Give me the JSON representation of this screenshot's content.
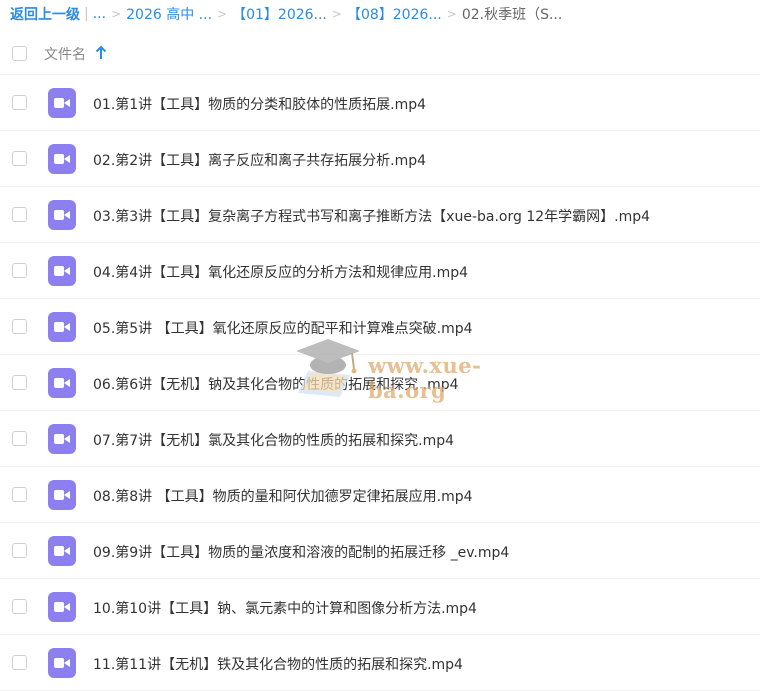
{
  "breadcrumb": {
    "back": "返回上一级",
    "bar": "|",
    "ellipsis": "...",
    "sep": ">",
    "items": [
      "2026 高中 ...",
      "【01】2026...",
      "【08】2026..."
    ],
    "current": "02.秋季班（S..."
  },
  "header": {
    "name_label": "文件名",
    "sort_icon": "arrow-up-icon"
  },
  "colors": {
    "link": "#2a8ce5",
    "video_icon": "#8c7ff0",
    "watermark": "#deaa6e"
  },
  "files": [
    {
      "name": "01.第1讲【工具】物质的分类和胶体的性质拓展.mp4",
      "icon": "video-file-icon"
    },
    {
      "name": "02.第2讲【工具】离子反应和离子共存拓展分析.mp4",
      "icon": "video-file-icon"
    },
    {
      "name": "03.第3讲【工具】复杂离子方程式书写和离子推断方法【xue-ba.org 12年学霸网】.mp4",
      "icon": "video-file-icon"
    },
    {
      "name": "04.第4讲【工具】氧化还原反应的分析方法和规律应用.mp4",
      "icon": "video-file-icon"
    },
    {
      "name": "05.第5讲 【工具】氧化还原反应的配平和计算难点突破.mp4",
      "icon": "video-file-icon"
    },
    {
      "name": "06.第6讲【无机】钠及其化合物的性质的拓展和探究 .mp4",
      "icon": "video-file-icon"
    },
    {
      "name": "07.第7讲【无机】氯及其化合物的性质的拓展和探究.mp4",
      "icon": "video-file-icon"
    },
    {
      "name": "08.第8讲 【工具】物质的量和阿伏加德罗定律拓展应用.mp4",
      "icon": "video-file-icon"
    },
    {
      "name": "09.第9讲【工具】物质的量浓度和溶液的配制的拓展迁移 _ev.mp4",
      "icon": "video-file-icon"
    },
    {
      "name": "10.第10讲【工具】钠、氯元素中的计算和图像分析方法.mp4",
      "icon": "video-file-icon"
    },
    {
      "name": "11.第11讲【无机】铁及其化合物的性质的拓展和探究.mp4",
      "icon": "video-file-icon"
    }
  ],
  "watermark": {
    "text": "www.xue-ba.org",
    "icon": "graduation-cap-icon"
  }
}
